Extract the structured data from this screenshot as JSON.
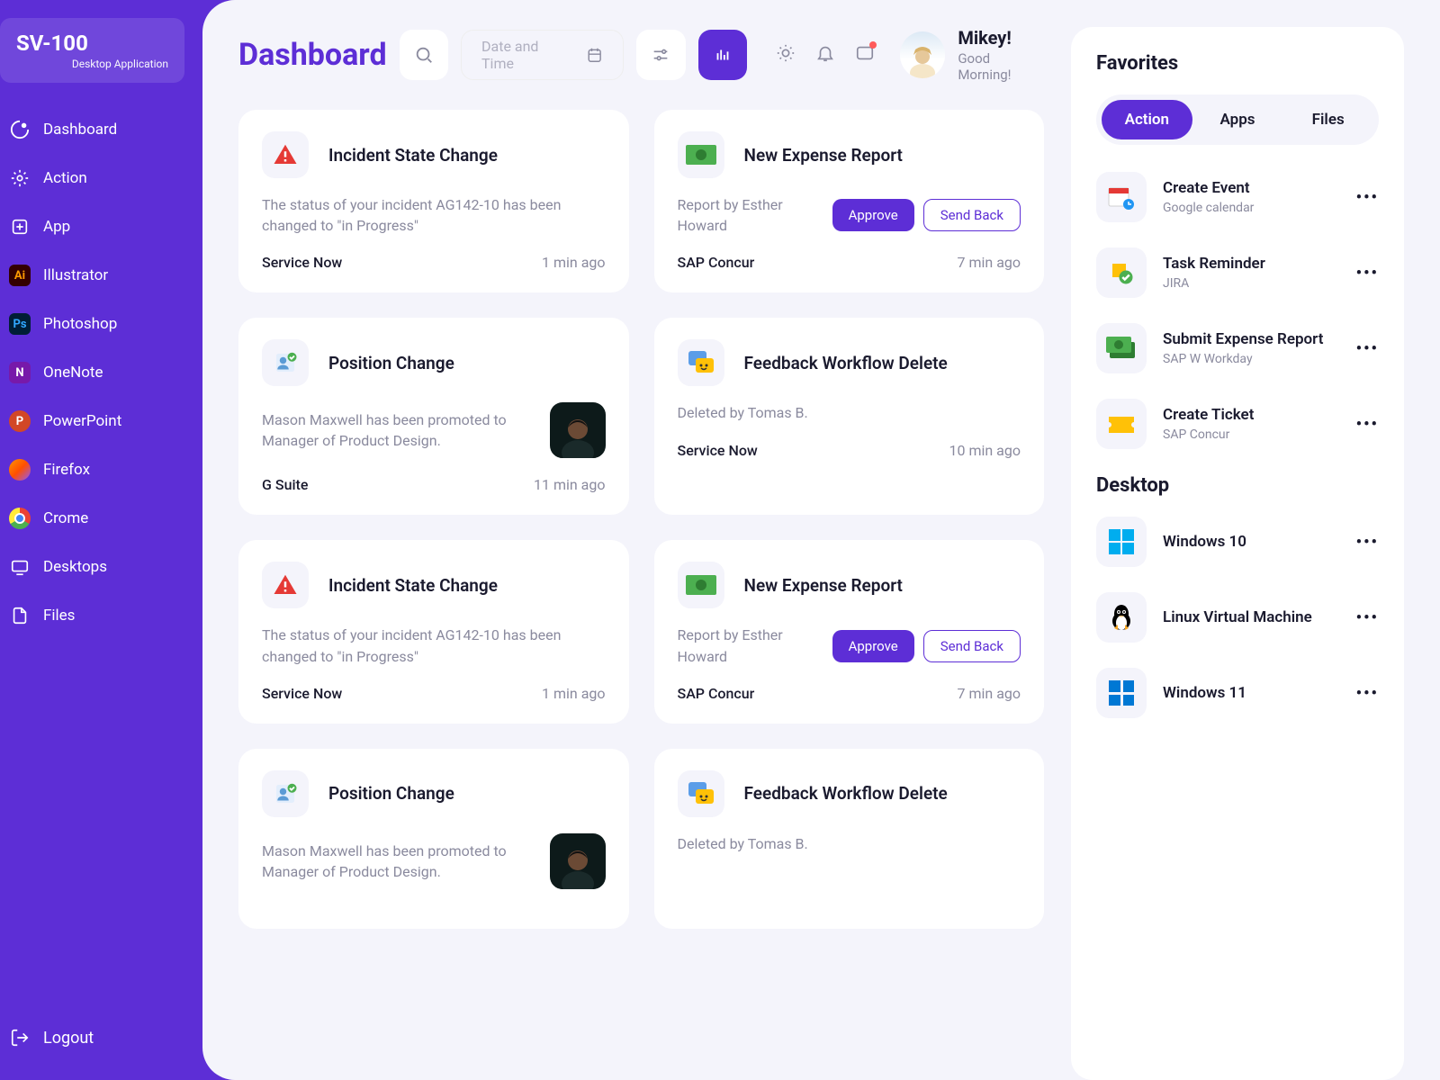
{
  "app": {
    "name": "SV-100",
    "subtitle": "Desktop Application"
  },
  "sidebar": {
    "items": [
      {
        "label": "Dashboard"
      },
      {
        "label": "Action"
      },
      {
        "label": "App"
      },
      {
        "label": "Illustrator"
      },
      {
        "label": "Photoshop"
      },
      {
        "label": "OneNote"
      },
      {
        "label": "PowerPoint"
      },
      {
        "label": "Firefox"
      },
      {
        "label": "Crome"
      },
      {
        "label": "Desktops"
      },
      {
        "label": "Files"
      }
    ],
    "logout": "Logout"
  },
  "header": {
    "title": "Dashboard",
    "date_placeholder": "Date and Time",
    "user_name": "Mikey!",
    "greeting": "Good Morning!"
  },
  "feed": [
    {
      "icon": "alert",
      "title": "Incident State Change",
      "text": "The status of your incident AG142-10 has been changed to \"in Progress\"",
      "source": "Service Now",
      "time": "1 min ago"
    },
    {
      "icon": "money",
      "title": "New Expense Report",
      "text": "Report by Esther Howard",
      "source": "SAP Concur",
      "time": "7 min ago",
      "approve": "Approve",
      "sendback": "Send Back"
    },
    {
      "icon": "person",
      "title": "Position Change",
      "text": "Mason Maxwell has been promoted to Manager of Product Design.",
      "source": "G Suite",
      "time": "11 min ago",
      "photo": true
    },
    {
      "icon": "feedback",
      "title": "Feedback Workflow Delete",
      "text": "Deleted by Tomas B.",
      "source": "Service Now",
      "time": "10 min ago"
    },
    {
      "icon": "alert",
      "title": "Incident State Change",
      "text": "The status of your incident AG142-10 has been changed to \"in Progress\"",
      "source": "Service Now",
      "time": "1 min ago"
    },
    {
      "icon": "money",
      "title": "New Expense Report",
      "text": "Report by Esther Howard",
      "source": "SAP Concur",
      "time": "7 min ago",
      "approve": "Approve",
      "sendback": "Send Back"
    },
    {
      "icon": "person",
      "title": "Position Change",
      "text": "Mason Maxwell has been promoted to Manager of Product Design.",
      "photo": true
    },
    {
      "icon": "feedback",
      "title": "Feedback Workflow Delete",
      "text": "Deleted by Tomas B."
    }
  ],
  "favorites": {
    "title": "Favorites",
    "tabs": [
      "Action",
      "Apps",
      "Files"
    ],
    "active_tab": 0,
    "items": [
      {
        "icon": "calendar",
        "title": "Create Event",
        "sub": "Google calendar"
      },
      {
        "icon": "reminder",
        "title": "Task Reminder",
        "sub": "JIRA"
      },
      {
        "icon": "expense",
        "title": "Submit Expense Report",
        "sub": "SAP W Workday"
      },
      {
        "icon": "ticket",
        "title": "Create Ticket",
        "sub": "SAP Concur"
      }
    ]
  },
  "desktop": {
    "title": "Desktop",
    "items": [
      {
        "icon": "win10",
        "title": "Windows 10"
      },
      {
        "icon": "linux",
        "title": "Linux Virtual Machine"
      },
      {
        "icon": "win11",
        "title": "Windows 11"
      }
    ]
  }
}
